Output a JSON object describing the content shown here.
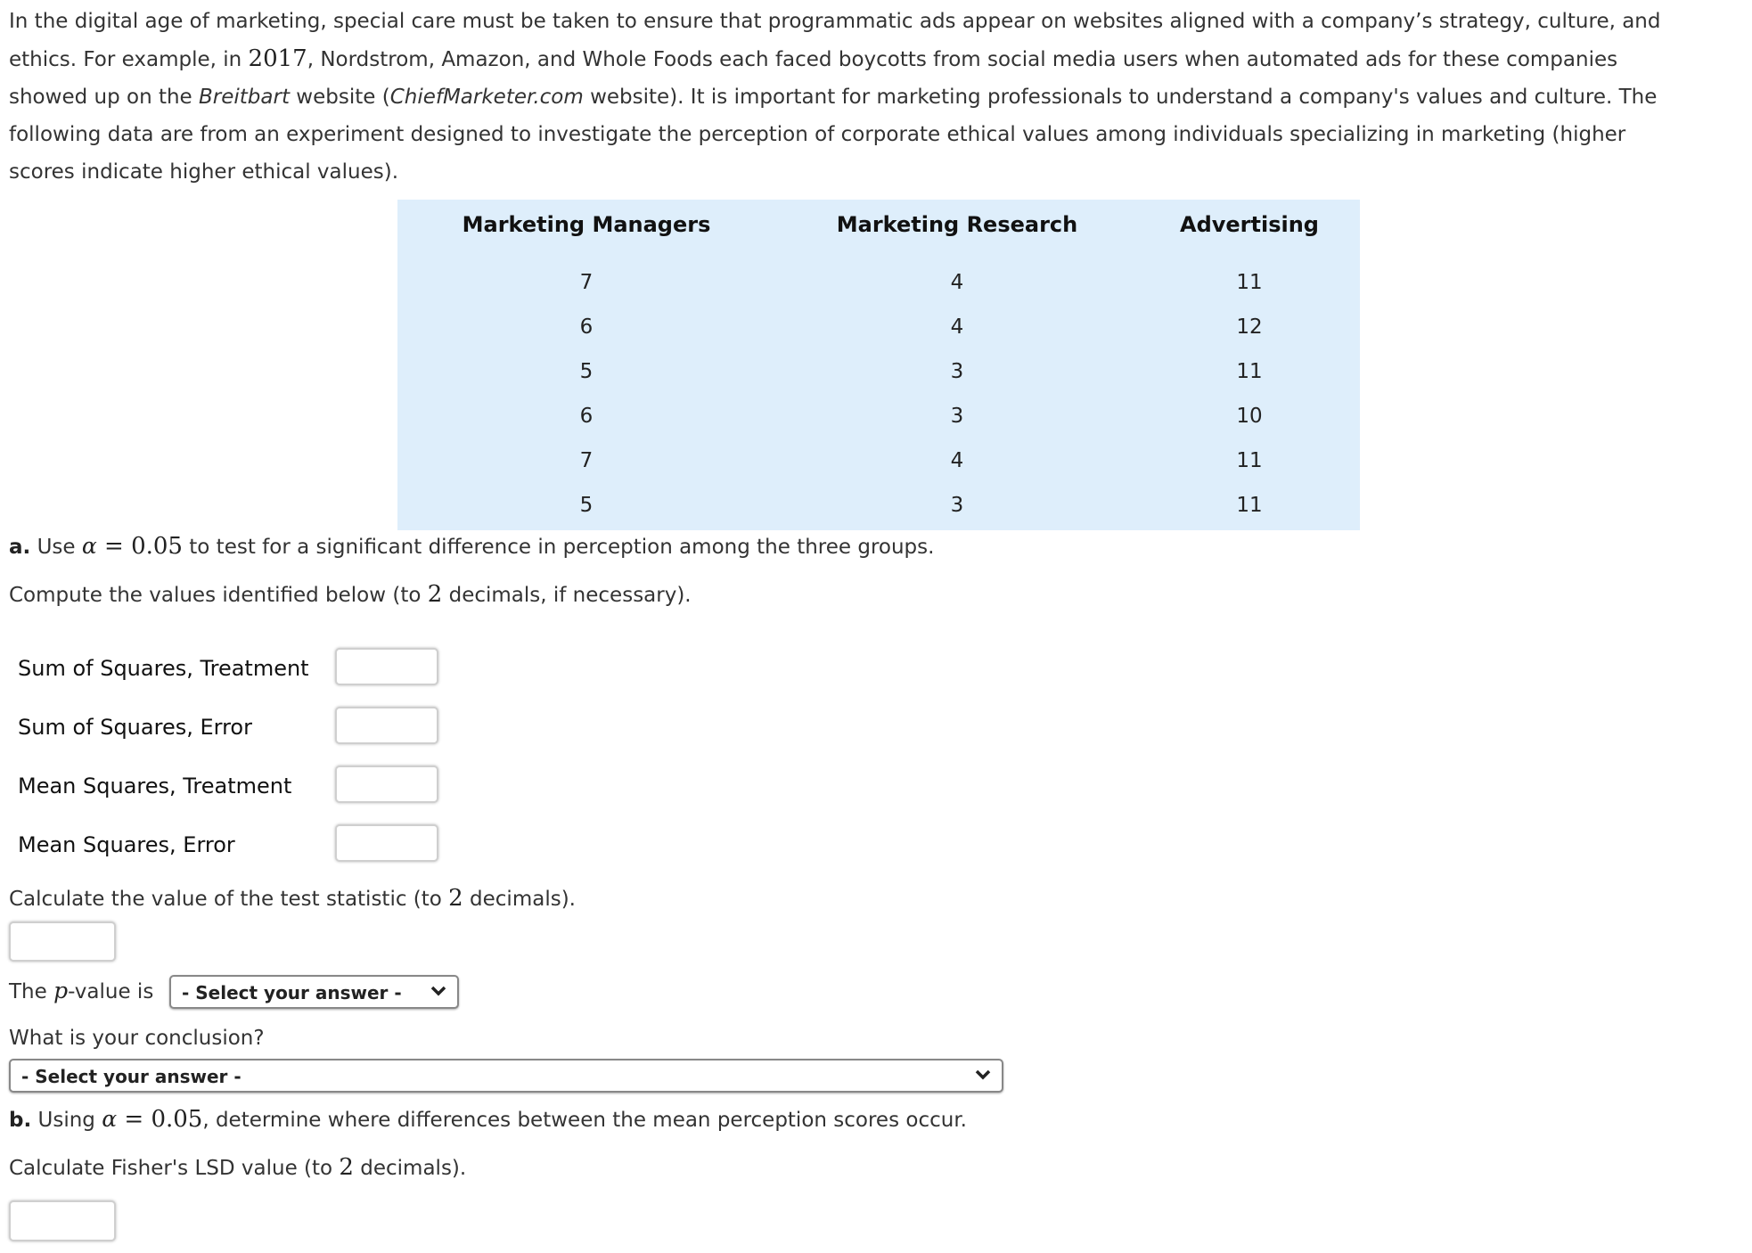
{
  "intro": {
    "line1": "In the digital age of marketing, special care must be taken to ensure that programmatic ads appear on websites aligned with a company’s strategy, culture, and",
    "line2_a": "ethics. For example, in ",
    "line2_year": "2017",
    "line2_b": ", Nordstrom, Amazon, and Whole Foods each faced boycotts from social media users when automated ads for these companies",
    "line3_a": "showed up on the ",
    "line3_breitbart": "Breitbart",
    "line3_b": " website (",
    "line3_source": "ChiefMarketer.com",
    "line3_c": " website). It is important for marketing professionals to understand a company's values and culture. The",
    "line4": "following data are from an experiment designed to investigate the perception of corporate ethical values among individuals specializing in marketing (higher",
    "line5": "scores indicate higher ethical values)."
  },
  "table": {
    "headers": [
      "Marketing Managers",
      "Marketing Research",
      "Advertising"
    ],
    "rows": [
      [
        "7",
        "4",
        "11"
      ],
      [
        "6",
        "4",
        "12"
      ],
      [
        "5",
        "3",
        "11"
      ],
      [
        "6",
        "3",
        "10"
      ],
      [
        "7",
        "4",
        "11"
      ],
      [
        "5",
        "3",
        "11"
      ]
    ]
  },
  "part_a": {
    "prefix": "a.",
    "use": " Use ",
    "alpha": "α",
    "eq": " = ",
    "alpha_value": "0.05",
    "rest": " to test for a significant difference in perception among the three groups.",
    "compute_a": "Compute the values identified below (to ",
    "compute_n": "2",
    "compute_b": " decimals, if necessary).",
    "fields": [
      {
        "label": "Sum of Squares, Treatment",
        "value": ""
      },
      {
        "label": "Sum of Squares, Error",
        "value": ""
      },
      {
        "label": "Mean Squares, Treatment",
        "value": ""
      },
      {
        "label": "Mean Squares, Error",
        "value": ""
      }
    ],
    "test_stat_a": "Calculate the value of the test statistic (to ",
    "test_stat_n": "2",
    "test_stat_b": " decimals).",
    "test_stat_value": "",
    "pvalue_a": "The ",
    "pvalue_p": "p",
    "pvalue_b": "-value is",
    "pvalue_select": "- Select your answer -",
    "conclusion_q": "What is your conclusion?",
    "conclusion_select": "- Select your answer -"
  },
  "part_b": {
    "prefix": "b.",
    "using": " Using ",
    "alpha": "α",
    "eq": " = ",
    "alpha_value": "0.05",
    "rest": ", determine where differences between the mean perception scores occur.",
    "lsd_a": "Calculate Fisher's LSD value (to ",
    "lsd_n": "2",
    "lsd_b": " decimals).",
    "lsd_value": ""
  }
}
